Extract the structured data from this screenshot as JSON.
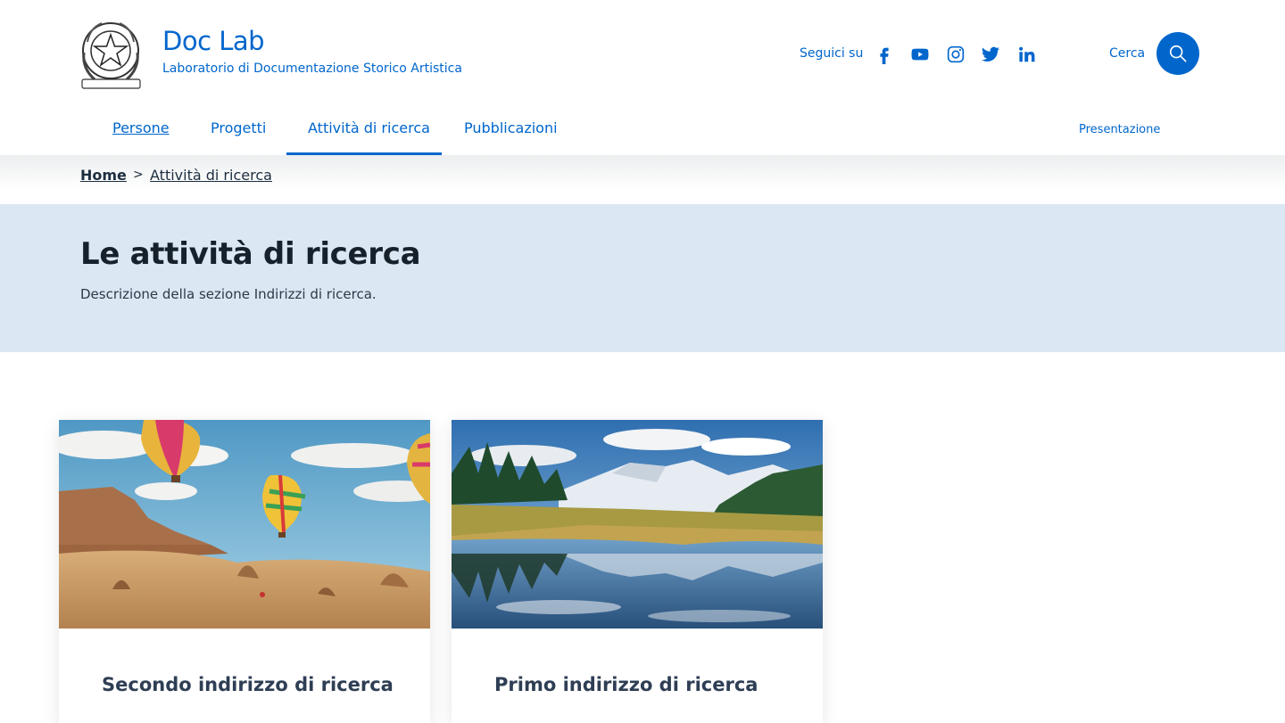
{
  "brand": {
    "title": "Doc Lab",
    "subtitle": "Laboratorio di Documentazione Storico Artistica",
    "emblem_icon": "italian-republic-emblem-icon"
  },
  "header": {
    "follow_label": "Seguici su",
    "social": [
      "facebook-icon",
      "youtube-icon",
      "instagram-icon",
      "twitter-icon",
      "linkedin-icon"
    ],
    "search_label": "Cerca",
    "search_icon": "search-icon"
  },
  "nav": {
    "items": [
      {
        "label": "Persone"
      },
      {
        "label": "Progetti"
      },
      {
        "label": "Attività di ricerca"
      },
      {
        "label": "Pubblicazioni"
      }
    ],
    "active": "Attività di ricerca",
    "right_link": "Presentazione"
  },
  "breadcrumb": {
    "home": "Home",
    "separator": ">",
    "current": "Attività di ricerca"
  },
  "hero": {
    "title": "Le attività di ricerca",
    "description": "Descrizione della sezione Indirizzi di ricerca."
  },
  "cards": [
    {
      "title": "Secondo indirizzo di ricerca"
    },
    {
      "title": "Primo indirizzo di ricerca"
    }
  ],
  "colors": {
    "primary": "#0066cc",
    "hero_background": "#dce7f4",
    "title_text": "#17212b"
  }
}
